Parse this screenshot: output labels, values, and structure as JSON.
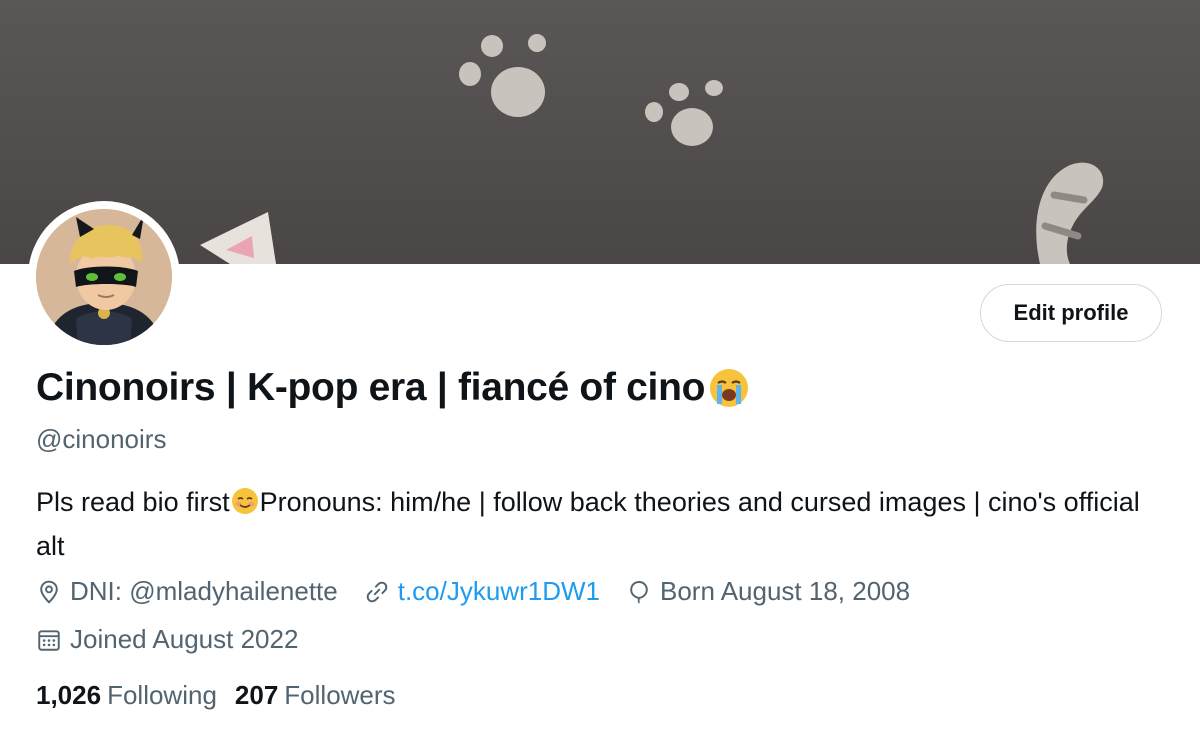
{
  "colors": {
    "banner": "#4f4b4a",
    "paw": "#c9c3bd",
    "text_primary": "#0f1419",
    "text_secondary": "#536471",
    "link": "#1d9bf0",
    "button_border": "#cfd9de"
  },
  "profile": {
    "display_name": "Cinonoirs | K-pop era | fiancé of cino",
    "display_name_emoji": "loudly-crying-face-emoji",
    "handle": "@cinonoirs",
    "bio_part1": "Pls read bio first",
    "bio_emoji": "smiling-face-emoji",
    "bio_part2": "Pronouns: him/he | follow back theories and cursed images | cino's official alt",
    "location": "DNI: @mladyhailenette",
    "website": "t.co/Jykuwr1DW1",
    "birthday": "Born August 18, 2008",
    "joined": "Joined August 2022",
    "following_count": "1,026",
    "following_label": "Following",
    "followers_count": "207",
    "followers_label": "Followers"
  },
  "actions": {
    "edit_profile_label": "Edit profile"
  },
  "icons": {
    "location": "location-pin-icon",
    "website": "link-icon",
    "birthday": "balloon-icon",
    "joined": "calendar-icon"
  }
}
